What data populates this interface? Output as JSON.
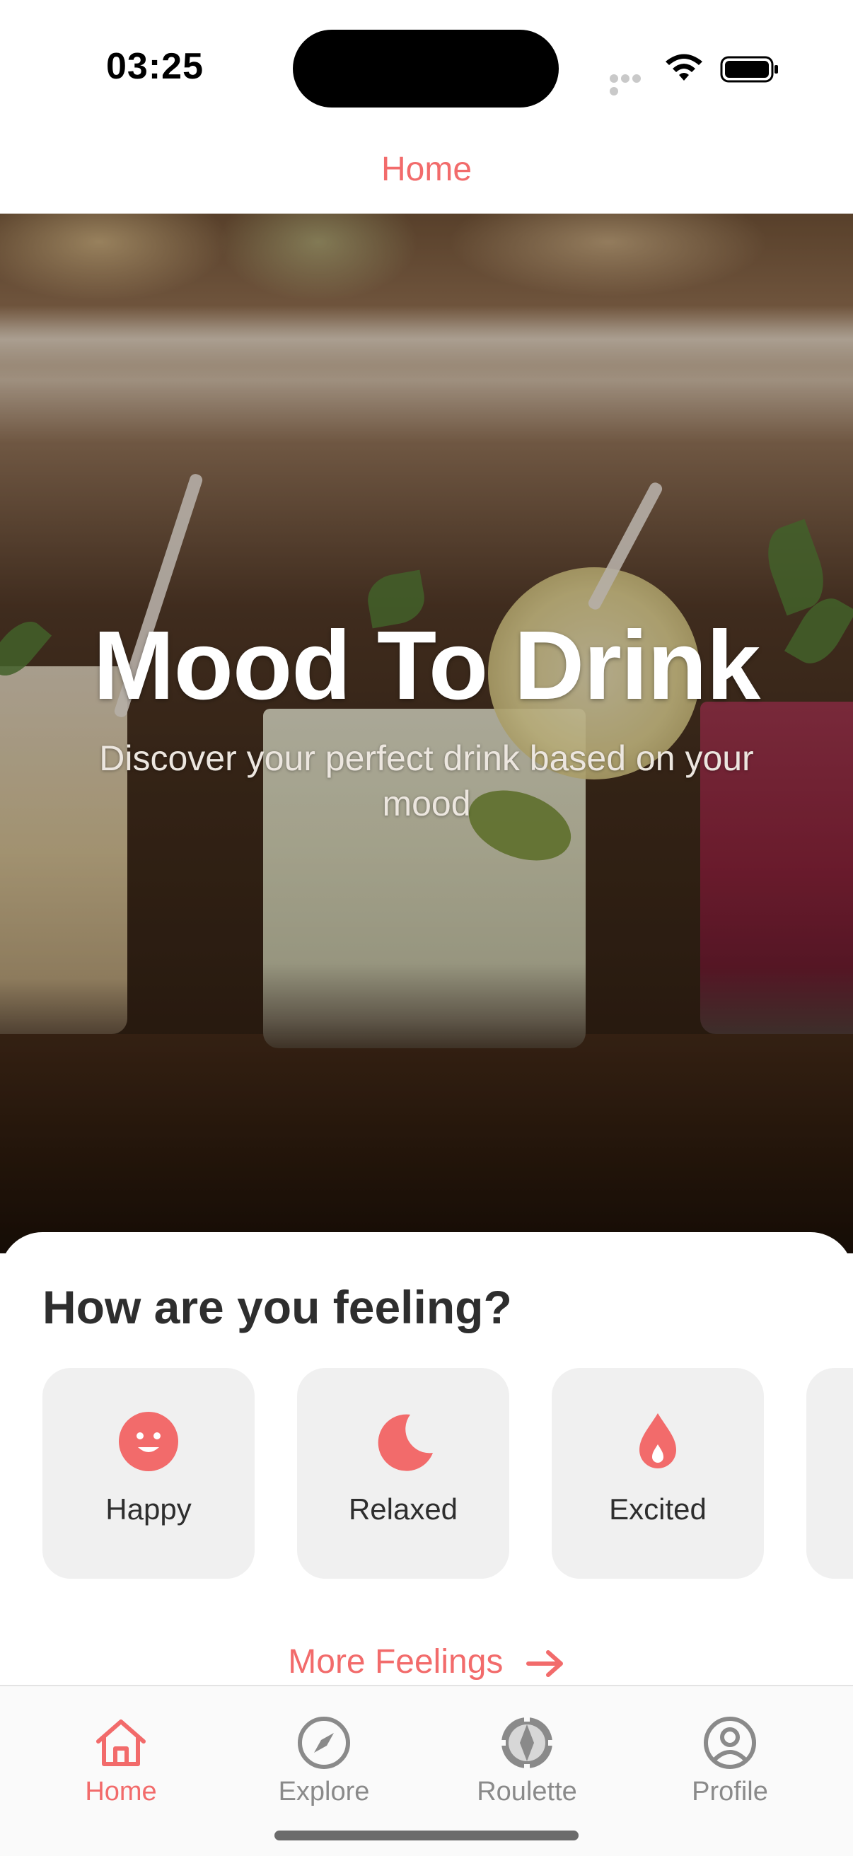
{
  "status_bar": {
    "time": "03:25"
  },
  "nav": {
    "title": "Home"
  },
  "hero": {
    "title": "Mood To Drink",
    "subtitle": "Discover your perfect drink based on your mood"
  },
  "feelings": {
    "heading": "How are you feeling?",
    "moods": [
      {
        "label": "Happy",
        "icon": "smiley-face-icon"
      },
      {
        "label": "Relaxed",
        "icon": "crescent-moon-icon"
      },
      {
        "label": "Excited",
        "icon": "flame-icon"
      },
      {
        "label": "",
        "icon": ""
      }
    ],
    "more_label": "More Feelings"
  },
  "tab_bar": {
    "tabs": [
      {
        "label": "Home",
        "icon": "house-icon",
        "active": true
      },
      {
        "label": "Explore",
        "icon": "compass-icon",
        "active": false
      },
      {
        "label": "Roulette",
        "icon": "roulette-wheel-icon",
        "active": false
      },
      {
        "label": "Profile",
        "icon": "person-circle-icon",
        "active": false
      }
    ]
  },
  "colors": {
    "accent": "#f26b6b",
    "card_background": "#f0f0f0",
    "text_dark": "#2e2e2e",
    "tab_inactive": "#8a8a8a"
  }
}
